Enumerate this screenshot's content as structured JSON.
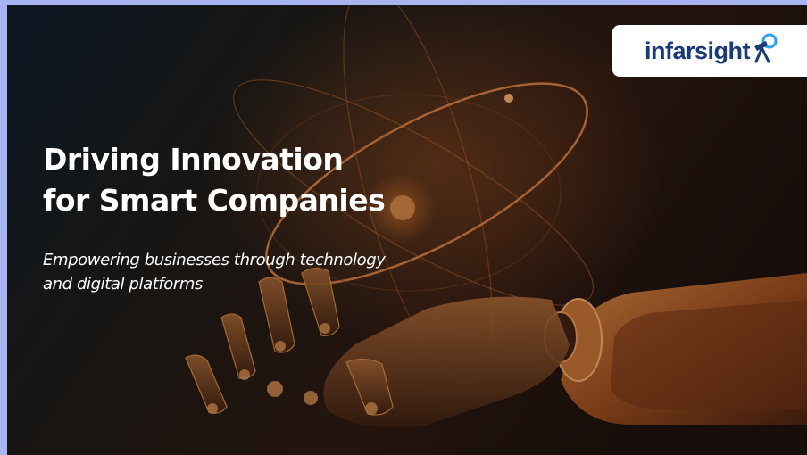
{
  "slide": {
    "headline_line1": "Driving Innovation",
    "headline_line2": "for Smart Companies",
    "subhead_line1": "Empowering businesses through technology",
    "subhead_line2": "and digital platforms"
  },
  "brand": {
    "logo_text": "infarsight",
    "logo_color": "#1d3a78",
    "accent_color": "#2aa3f2"
  },
  "background": {
    "image": "robotic-hand-with-orbit-lines",
    "tint_color": "#c8661f",
    "base_color": "#0c1622"
  }
}
